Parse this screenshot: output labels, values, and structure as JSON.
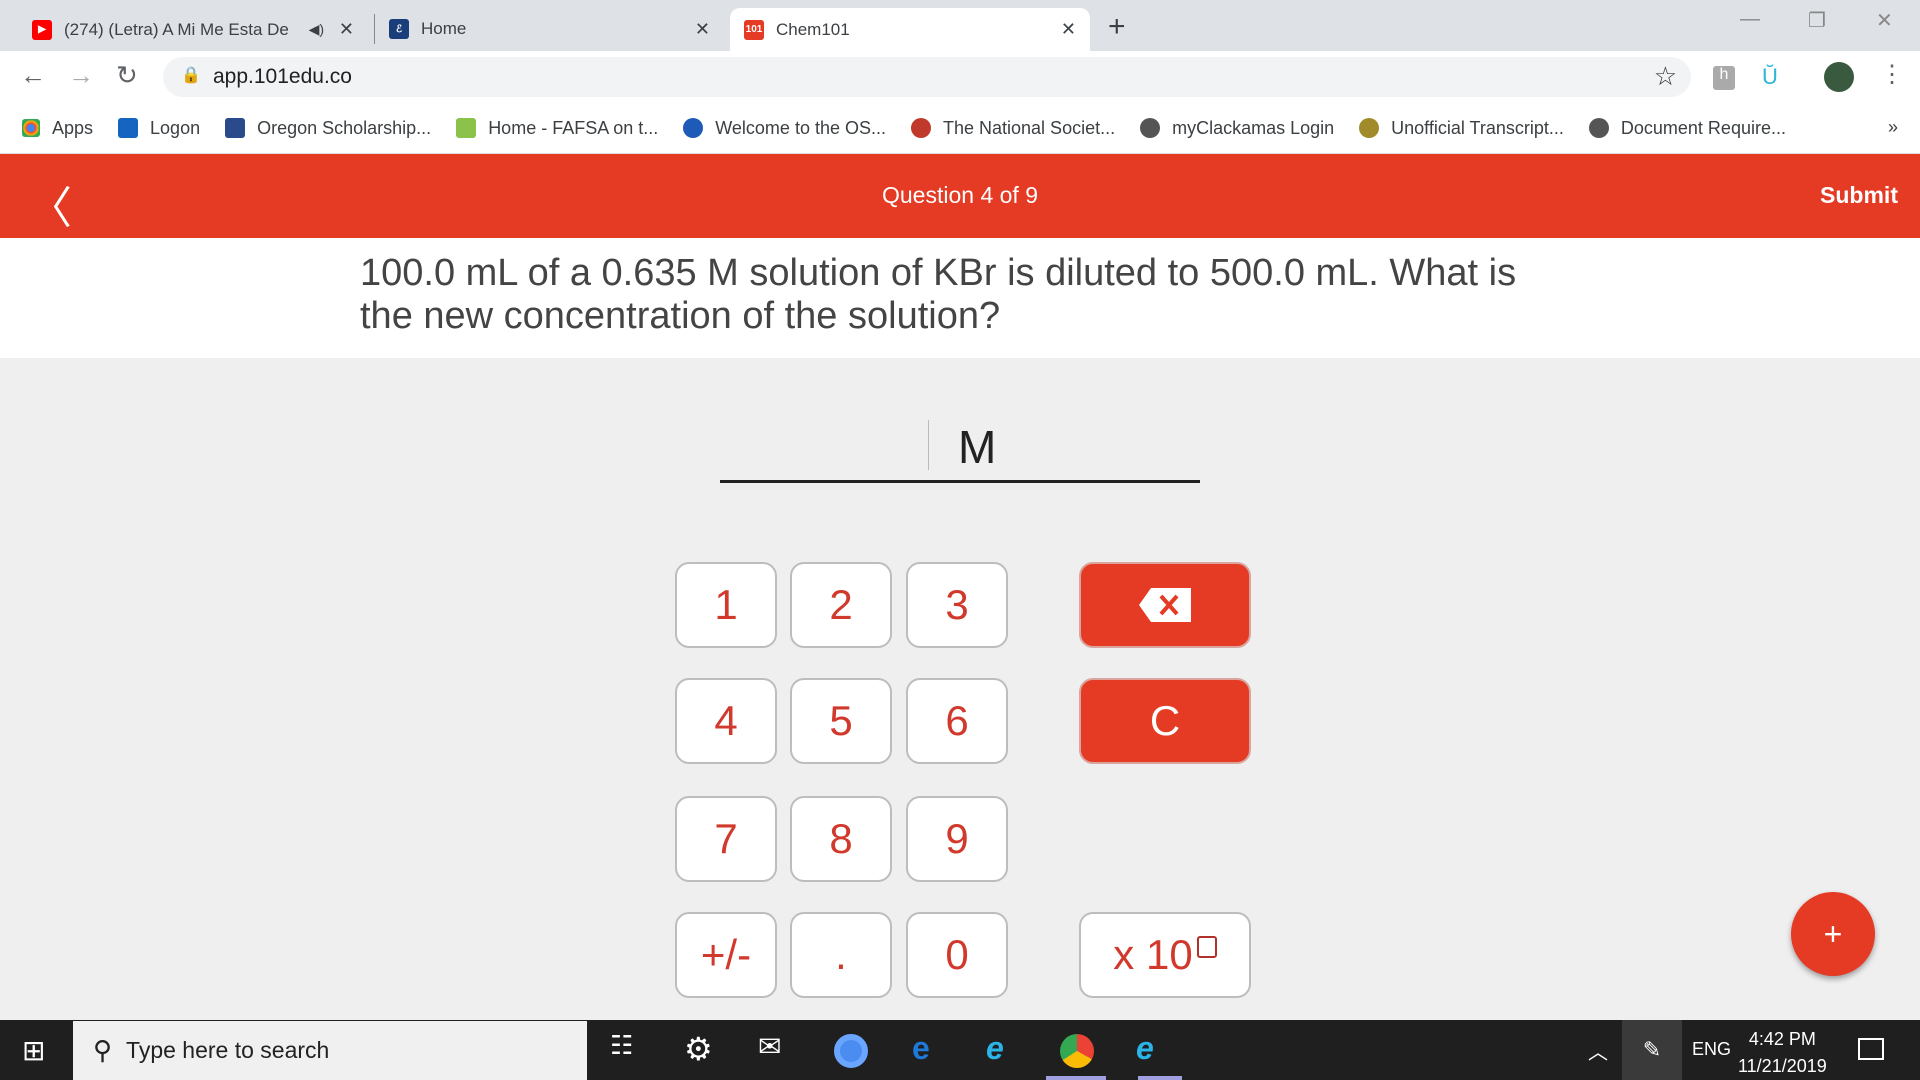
{
  "browser": {
    "tabs": [
      {
        "title": "(274) (Letra) A Mi Me Esta De",
        "icon": "youtube-icon",
        "color": "#ff0000",
        "audio": true
      },
      {
        "title": "Home",
        "icon": "home-site-icon",
        "color": "#1a3e7a"
      },
      {
        "title": "Chem101",
        "icon": "chem101-icon",
        "favicon_text": "101",
        "color": "#e53a23",
        "active": true
      }
    ],
    "url": "app.101edu.co",
    "bookmarks": [
      {
        "label": "Apps",
        "color": "#4285f4"
      },
      {
        "label": "Logon",
        "color": "#1565c0"
      },
      {
        "label": "Oregon Scholarship...",
        "color": "#2b4a8b"
      },
      {
        "label": "Home - FAFSA on t...",
        "color": "#8bc34a"
      },
      {
        "label": "Welcome to the OS...",
        "color": "#1e5bb8"
      },
      {
        "label": "The National Societ...",
        "color": "#c0392b"
      },
      {
        "label": "myClackamas Login",
        "color": "#555555"
      },
      {
        "label": "Unofficial Transcript...",
        "color": "#a08a2a"
      },
      {
        "label": "Document Require...",
        "color": "#555555"
      }
    ],
    "more": "»"
  },
  "app": {
    "accent": "#e53a23",
    "header": {
      "title": "Question 4 of 9",
      "submit": "Submit"
    },
    "question": "100.0 mL of a 0.635 M solution of KBr is diluted to 500.0 mL. What is the new concentration of the solution?",
    "answer": {
      "value": "",
      "unit": "M"
    },
    "keypad": [
      "1",
      "2",
      "3",
      "4",
      "5",
      "6",
      "7",
      "8",
      "9",
      "+/-",
      ".",
      "0"
    ],
    "clear": "C",
    "exponent": "x 10",
    "fab": "+"
  },
  "taskbar": {
    "search_placeholder": "Type here to search",
    "language": "ENG",
    "time": "4:42 PM",
    "date": "11/21/2019"
  }
}
